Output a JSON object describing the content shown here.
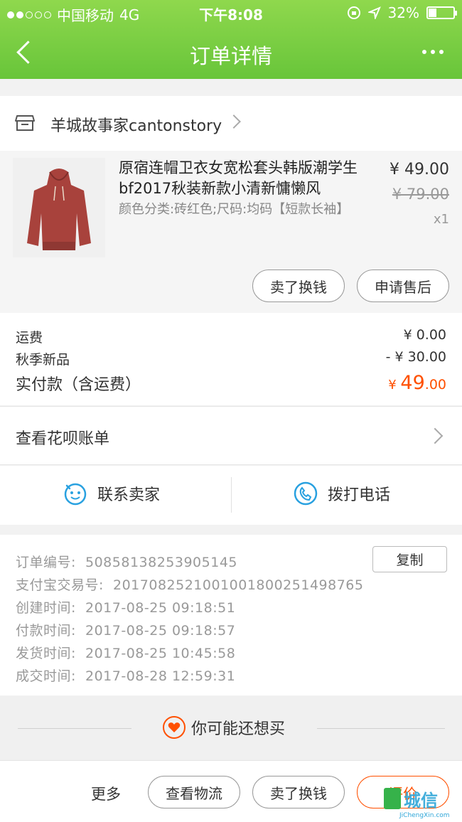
{
  "status_bar": {
    "carrier": "中国移动",
    "network": "4G",
    "time": "下午8:08",
    "battery": "32%",
    "battery_level": 0.32,
    "signal_bars_on": 2
  },
  "nav": {
    "title": "订单详情"
  },
  "shop": {
    "name": "羊城故事家cantonstory"
  },
  "product": {
    "title": "原宿连帽卫衣女宽松套头韩版潮学生bf2017秋装新款小清新慵懒风",
    "spec": "颜色分类:砖红色;尺码:均码【短款长袖】",
    "price": "¥ 49.00",
    "original_price": "¥ 79.00",
    "quantity": "x1",
    "sell_button": "卖了换钱",
    "aftersale_button": "申请售后",
    "image_color": "#a8423c"
  },
  "fees": {
    "shipping_label": "运费",
    "shipping_value": "¥ 0.00",
    "discount_label": "秋季新品",
    "discount_value": "- ¥ 30.00",
    "total_label": "实付款（含运费）",
    "total_currency": "¥ ",
    "total_int": "49",
    "total_dec": ".00"
  },
  "huabei": {
    "label": "查看花呗账单"
  },
  "contact": {
    "seller": "联系卖家",
    "phone": "拨打电话"
  },
  "order_info": {
    "copy_button": "复制",
    "rows": [
      {
        "label": "订单编号:",
        "value": "50858138253905145"
      },
      {
        "label": "支付宝交易号:",
        "value": "2017082521001001800251498765"
      },
      {
        "label": "创建时间:",
        "value": "2017-08-25 09:18:51"
      },
      {
        "label": "付款时间:",
        "value": "2017-08-25 09:18:57"
      },
      {
        "label": "发货时间:",
        "value": "2017-08-25 10:45:58"
      },
      {
        "label": "成交时间:",
        "value": "2017-08-28 12:59:31"
      }
    ]
  },
  "recommend": {
    "title": "你可能还想买"
  },
  "bottom_bar": {
    "more": "更多",
    "logistics": "查看物流",
    "sell": "卖了换钱",
    "review": "评价"
  },
  "watermark": {
    "text": "城信",
    "sub": "JiChengXin.com"
  },
  "colors": {
    "accent": "#ff5000",
    "header_green": "#68c53a",
    "icon_blue": "#29a1e0"
  }
}
